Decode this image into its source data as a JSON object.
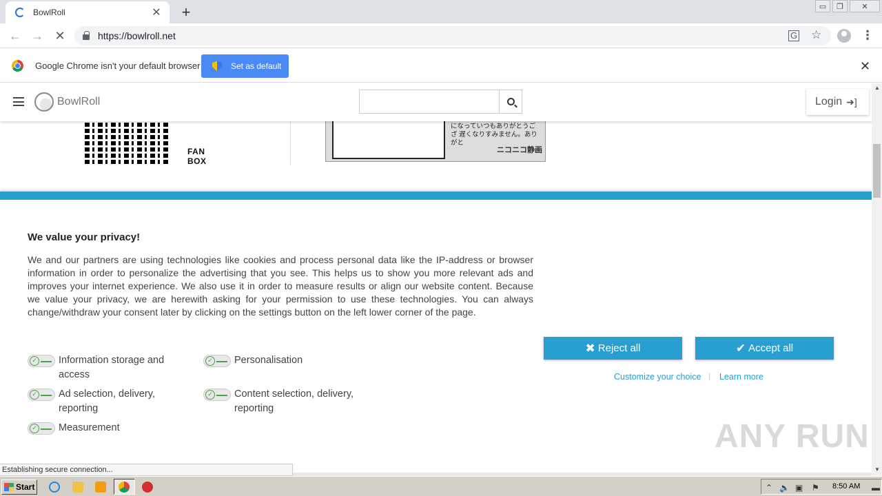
{
  "browser": {
    "tab_title": "BowlRoll",
    "tab_close": "✕",
    "new_tab": "+",
    "url": "https://bowlroll.net",
    "window_controls": {
      "minimize": "▭",
      "maximize": "❐",
      "close": "✕"
    }
  },
  "infobar": {
    "message": "Google Chrome isn't your default browser",
    "set_default_label": "Set as default",
    "close": "✕"
  },
  "site": {
    "logo_text": "BowlRoll",
    "search_placeholder": "",
    "login_label": "Login",
    "fanbox_label_1": "FAN",
    "fanbox_label_2": "BOX",
    "nico_text": "になっていつもありがとうござ 遅くなりすみません。ありがと",
    "nico_logo": "ニコニコ静画"
  },
  "consent": {
    "title": "We value your privacy!",
    "body": "We and our partners are using technologies like cookies and process personal data like the IP-address or browser information in order to personalize the advertising that you see. This helps us to show you more relevant ads and improves your internet experience. We also use it in order to measure results or align our website content. Because we value your privacy, we are herewith asking for your permission to use these technologies. You can always change/withdraw your consent later by clicking on the settings button on the left lower corner of the page.",
    "purposes": [
      {
        "label": "Information storage and access"
      },
      {
        "label": "Personalisation"
      },
      {
        "label": "Ad selection, delivery, reporting"
      },
      {
        "label": "Content selection, delivery, reporting"
      },
      {
        "label": "Measurement"
      }
    ],
    "reject_label": "Reject all",
    "accept_label": "Accept all",
    "customize_label": "Customize your choice",
    "separator": "|",
    "learn_more_label": "Learn more",
    "accent_color": "#299fd1"
  },
  "status_text": "Establishing secure connection...",
  "watermark": "ANY RUN",
  "taskbar": {
    "start_label": "Start",
    "clock": "8:50 AM"
  }
}
